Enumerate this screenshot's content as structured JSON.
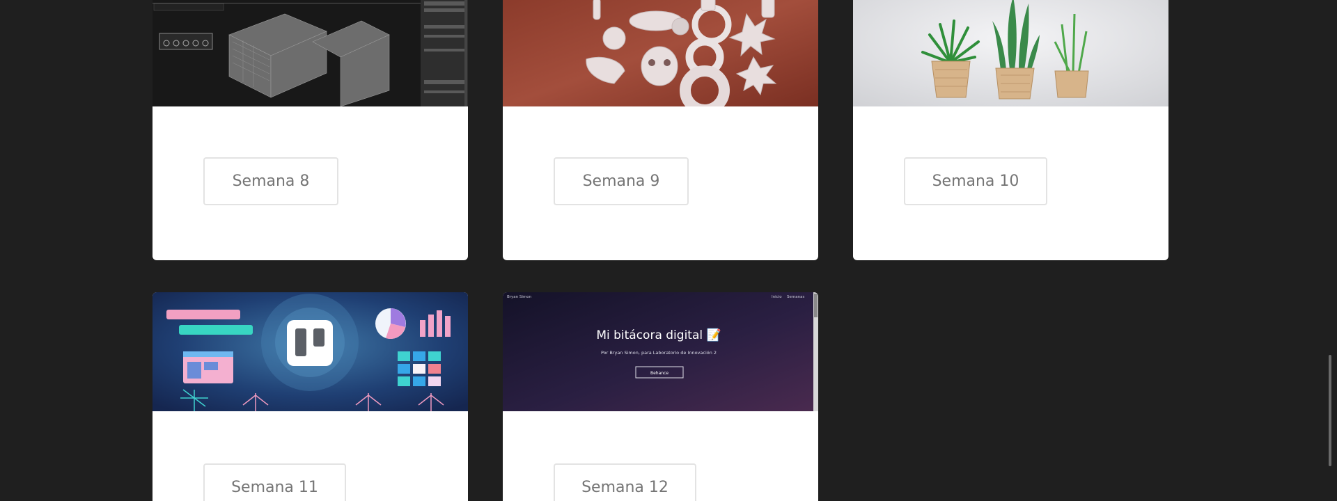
{
  "cards": [
    {
      "label": "Semana 8",
      "image": "3d-modeling-software-screenshot"
    },
    {
      "label": "Semana 9",
      "image": "3d-printed-objects-photo"
    },
    {
      "label": "Semana 10",
      "image": "3d-printed-planters-photo"
    },
    {
      "label": "Semana 11",
      "image": "trello-illustration"
    },
    {
      "label": "Semana 12",
      "image": "blog-homepage-screenshot"
    }
  ],
  "blog_preview": {
    "brand": "Bryan Simon",
    "nav_inicio": "Inicio",
    "nav_semanas": "Semanas",
    "heading": "Mi bitácora digital 📝",
    "subtitle": "Por Bryan Simon, para Laboratorio de Innovación 2",
    "button": "Behance"
  },
  "colors": {
    "background": "#1f1f1f",
    "card": "#ffffff",
    "button_border": "#e3e3e3",
    "button_text": "#757575"
  }
}
